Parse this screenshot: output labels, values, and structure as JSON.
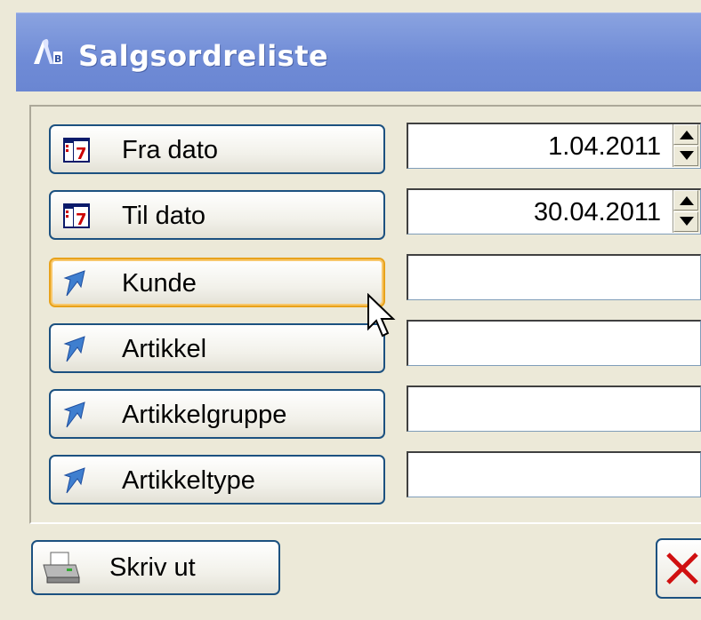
{
  "window": {
    "title": "Salgsordreliste"
  },
  "filters": [
    {
      "label": "Fra dato",
      "icon": "calendar-icon",
      "value": "1.04.2011",
      "spinner": true
    },
    {
      "label": "Til dato",
      "icon": "calendar-icon",
      "value": "30.04.2011",
      "spinner": true
    },
    {
      "label": "Kunde",
      "icon": "arrow-icon",
      "value": "",
      "spinner": false
    },
    {
      "label": "Artikkel",
      "icon": "arrow-icon",
      "value": "",
      "spinner": false
    },
    {
      "label": "Artikkelgruppe",
      "icon": "arrow-icon",
      "value": "",
      "spinner": false
    },
    {
      "label": "Artikkeltype",
      "icon": "arrow-icon",
      "value": "",
      "spinner": false
    }
  ],
  "actions": {
    "print_label": "Skriv ut",
    "cancel_icon": "close-icon"
  },
  "colors": {
    "titlebar": "#7690d8",
    "button_border": "#1c5180",
    "hover_border": "#e8a21b",
    "face": "#ece9d8"
  }
}
